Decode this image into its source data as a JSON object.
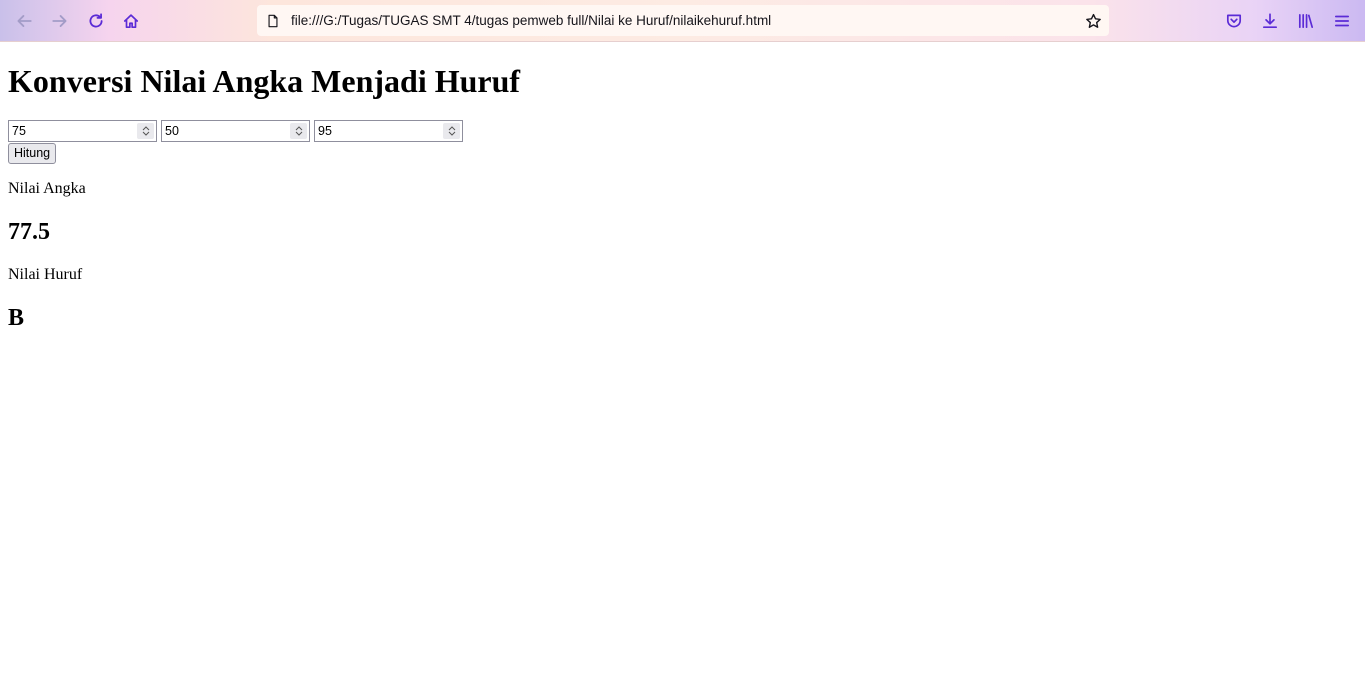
{
  "browser": {
    "url": "file:///G:/Tugas/TUGAS SMT 4/tugas pemweb full/Nilai ke Huruf/nilaikehuruf.html",
    "toolbar_icons": [
      "back-arrow-icon",
      "forward-arrow-icon",
      "reload-icon",
      "home-icon",
      "page-icon",
      "bookmark-star-icon",
      "pocket-icon",
      "download-icon",
      "library-icon",
      "menu-icon"
    ]
  },
  "page": {
    "title": "Konversi Nilai Angka Menjadi Huruf",
    "inputs": [
      "75",
      "50",
      "95"
    ],
    "button_label": "Hitung",
    "label_angka": "Nilai Angka",
    "result_angka": "77.5",
    "label_huruf": "Nilai Huruf",
    "result_huruf": "B"
  },
  "colors": {
    "icon_purple": "#5b2bd6",
    "icon_dark": "#15141a"
  }
}
